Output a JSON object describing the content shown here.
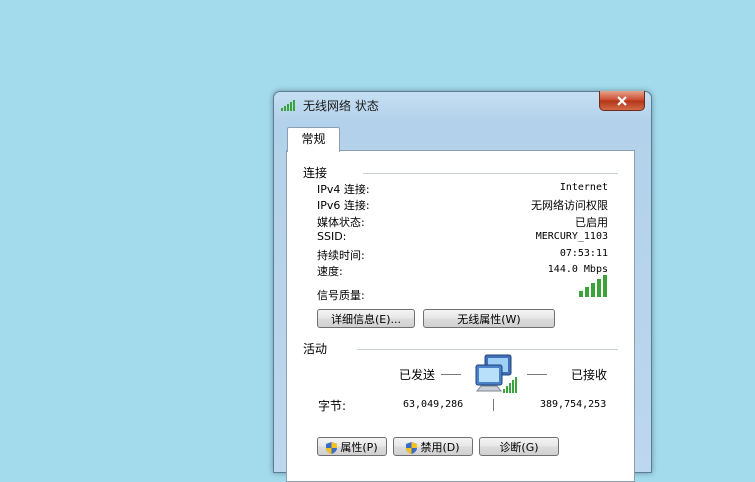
{
  "window": {
    "title": "无线网络 状态",
    "close_glyph": "×"
  },
  "tab": {
    "label": "常规"
  },
  "connection": {
    "heading": "连接",
    "rows": [
      {
        "label": "IPv4 连接:",
        "value": "Internet"
      },
      {
        "label": "IPv6 连接:",
        "value": "无网络访问权限"
      },
      {
        "label": "媒体状态:",
        "value": "已启用"
      },
      {
        "label": "SSID:",
        "value": "MERCURY_1103"
      },
      {
        "label": "持续时间:",
        "value": "07:53:11"
      },
      {
        "label": "速度:",
        "value": "144.0 Mbps"
      }
    ],
    "signal_label": "信号质量:",
    "signal_bars": 5,
    "signal_max": 5,
    "details_button": "详细信息(E)...",
    "wireless_props_button": "无线属性(W)"
  },
  "activity": {
    "heading": "活动",
    "sent_label": "已发送",
    "received_label": "已接收",
    "bytes_label": "字节:",
    "bytes_sent": "63,049,286",
    "bytes_received": "389,754,253"
  },
  "footer_buttons": {
    "properties": "属性(P)",
    "disable": "禁用(D)",
    "diagnose": "诊断(G)"
  },
  "colors": {
    "desktop": "#a3dbec",
    "signal_green": "#3aa33a",
    "close_red": "#c8472a"
  },
  "icons": {
    "title": "wifi-signal-icon",
    "network": "network-computers-icon",
    "shield": "uac-shield-icon"
  }
}
